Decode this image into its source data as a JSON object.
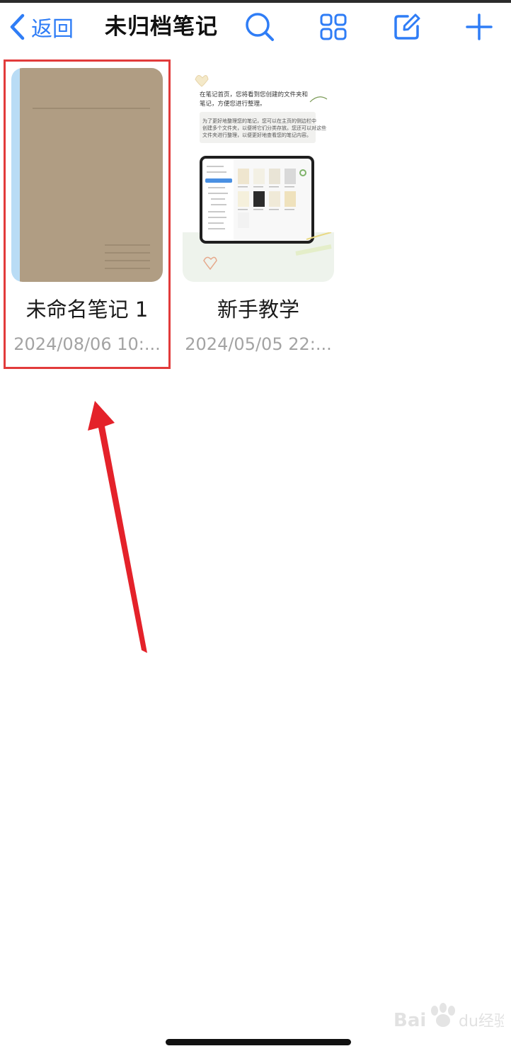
{
  "navbar": {
    "back_label": "返回",
    "title": "未归档笔记",
    "icons": [
      "search-icon",
      "grid-view-icon",
      "edit-icon",
      "add-icon"
    ]
  },
  "notes": [
    {
      "title": "未命名笔记 1",
      "date": "2024/08/06 10:...",
      "thumbnail": "brown-notebook-cover",
      "highlighted": true
    },
    {
      "title": "新手教学",
      "date": "2024/05/05 22:...",
      "thumbnail": "tutorial-page"
    }
  ],
  "tutorial_text": {
    "line1": "在笔记首页，您将看到您创建的文件夹和",
    "line2": "笔记，方便您进行整理。",
    "box_line1": "为了更好地整理您的笔记，您可以在主页的侧边栏中",
    "box_line2": "创建多个文件夹，以便将它们分类存放。您还可以对这些",
    "box_line3": "文件夹进行整理，以便更好地查看您的笔记内容。"
  },
  "colors": {
    "accent": "#2f7df6",
    "highlight": "#e23b3b",
    "arrow": "#e4222a",
    "cover": "#b09d83",
    "spine": "#b9dcf5"
  },
  "watermark": "Baidu经验"
}
